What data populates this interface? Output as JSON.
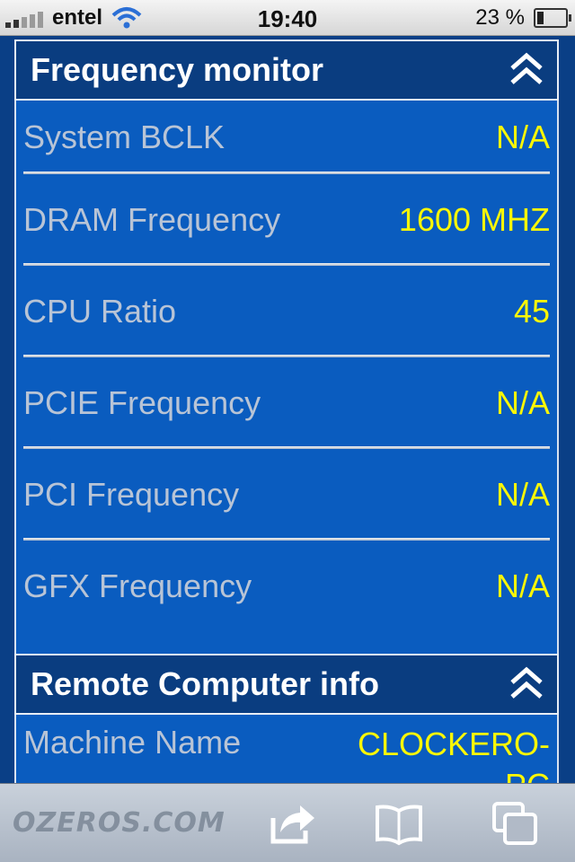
{
  "status_bar": {
    "carrier": "entel",
    "time": "19:40",
    "battery": "23 %",
    "battery_level_percent": 23
  },
  "frequency_monitor": {
    "title": "Frequency monitor",
    "rows": [
      {
        "label": "System BCLK",
        "value": "N/A"
      },
      {
        "label": "DRAM Frequency",
        "value": "1600 MHZ"
      },
      {
        "label": "CPU Ratio",
        "value": "45"
      },
      {
        "label": "PCIE Frequency",
        "value": "N/A"
      },
      {
        "label": "PCI Frequency",
        "value": "N/A"
      },
      {
        "label": "GFX Frequency",
        "value": "N/A"
      }
    ]
  },
  "remote_computer_info": {
    "title": "Remote Computer info",
    "rows": [
      {
        "label": "Machine Name",
        "value": "CLOCKERO-PC"
      }
    ]
  },
  "toolbar": {
    "logo_text": "OZEROS.COM",
    "icons": [
      "share-icon",
      "bookmarks-icon",
      "tabs-icon"
    ]
  },
  "colors": {
    "page_background": "#0a3f86",
    "panel_background": "#0a5cbf",
    "header_background": "#0a3d80",
    "label_color": "#b8c4d6",
    "value_color": "#fbf705"
  }
}
